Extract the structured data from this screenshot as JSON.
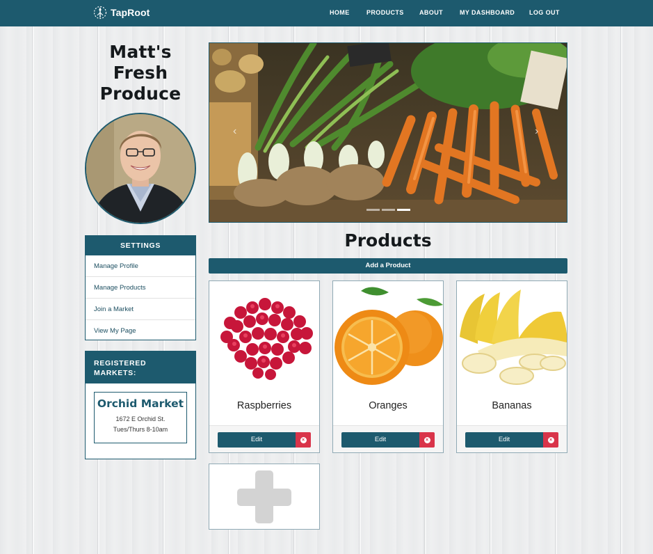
{
  "nav": {
    "brand": "TapRoot",
    "links": [
      "HOME",
      "PRODUCTS",
      "ABOUT",
      "MY DASHBOARD",
      "LOG OUT"
    ]
  },
  "profile": {
    "shop_name_lines": [
      "Matt's",
      "Fresh",
      "Produce"
    ]
  },
  "settings": {
    "title": "SETTINGS",
    "items": [
      "Manage Profile",
      "Manage Products",
      "Join a Market",
      "View My Page"
    ]
  },
  "markets": {
    "title_lines": [
      "REGISTERED",
      "MARKETS:"
    ],
    "list": [
      {
        "name": "Orchid Market",
        "address": "1672 E Orchid St.",
        "hours": "Tues/Thurs 8-10am"
      }
    ]
  },
  "carousel": {
    "slide_count": 3,
    "active_index": 2
  },
  "products": {
    "title": "Products",
    "add_label": "Add a Product",
    "edit_label": "Edit",
    "items": [
      {
        "name": "Raspberries",
        "image": "raspberries"
      },
      {
        "name": "Oranges",
        "image": "oranges"
      },
      {
        "name": "Bananas",
        "image": "bananas"
      }
    ]
  },
  "colors": {
    "brand": "#1d5a6e",
    "delete": "#d9344a",
    "add_placeholder": "#d3d3d3"
  }
}
